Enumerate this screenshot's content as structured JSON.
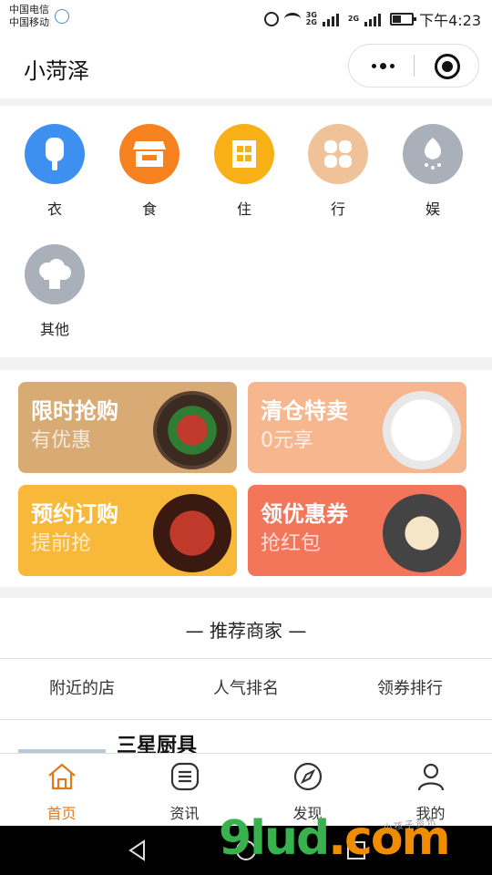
{
  "status_bar": {
    "carrier_1": "中国电信",
    "carrier_2": "中国移动",
    "net_1": "3G\n2G",
    "net_2": "2G",
    "time": "下午4:23",
    "battery_level": 0.45
  },
  "header": {
    "title": "小菏泽"
  },
  "categories": [
    {
      "label": "衣",
      "icon": "popsicle-icon",
      "color": "#3d8ff0"
    },
    {
      "label": "食",
      "icon": "shop-icon",
      "color": "#f5821f"
    },
    {
      "label": "住",
      "icon": "building-icon",
      "color": "#f7b116"
    },
    {
      "label": "行",
      "icon": "clover-icon",
      "color": "#f0c29a"
    },
    {
      "label": "娱",
      "icon": "balloon-icon",
      "color": "#a9b0ba"
    },
    {
      "label": "其他",
      "icon": "cloud-icon",
      "color": "#a9b0ba"
    }
  ],
  "promos": [
    {
      "title": "限时抢购",
      "subtitle": "有优惠",
      "bg": "#d8ab74",
      "art": "food-bowl-image"
    },
    {
      "title": "清仓特卖",
      "subtitle": "0元享",
      "bg": "#f6b78e",
      "art": "tableware-image"
    },
    {
      "title": "预约订购",
      "subtitle": "提前抢",
      "bg": "#f8b93a",
      "art": "crab-dish-image"
    },
    {
      "title": "领优惠券",
      "subtitle": "抢红包",
      "bg": "#f3755a",
      "art": "popcorn-image"
    }
  ],
  "merchants": {
    "heading": "— 推荐商家 —",
    "tabs": [
      "附近的店",
      "人气排名",
      "领券排行"
    ],
    "first_shop_name": "三星厨具"
  },
  "tab_bar": [
    {
      "label": "首页",
      "icon": "home-icon",
      "active": true
    },
    {
      "label": "资讯",
      "icon": "list-icon",
      "active": false
    },
    {
      "label": "发现",
      "icon": "compass-icon",
      "active": false
    },
    {
      "label": "我的",
      "icon": "user-icon",
      "active": false
    }
  ],
  "watermark": {
    "main": "9lud",
    "suffix": ".com",
    "sub": "小孩子资讯"
  },
  "colors": {
    "accent": "#e07a1f"
  }
}
